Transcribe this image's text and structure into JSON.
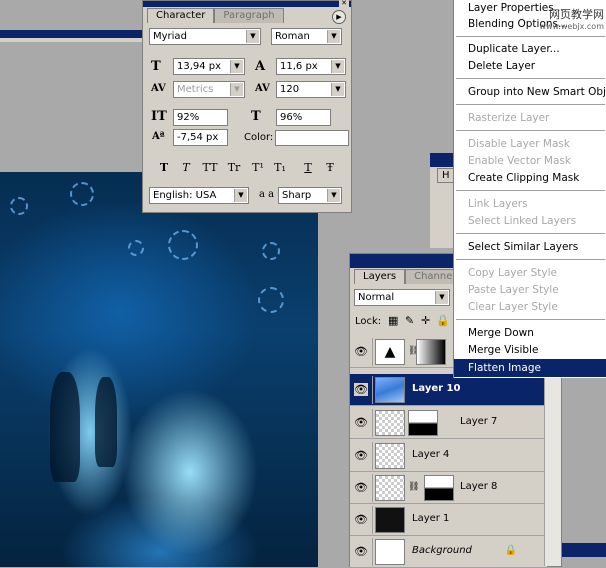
{
  "character_panel": {
    "tabs": [
      "Character",
      "Paragraph"
    ],
    "font_family": "Myriad",
    "font_style": "Roman",
    "font_size": "13,94 px",
    "leading": "11,6 px",
    "kerning": "Metrics",
    "tracking": "120",
    "vertical_scale": "92%",
    "horizontal_scale": "96%",
    "baseline_shift": "-7,54 px",
    "color_label": "Color:",
    "language": "English: USA",
    "antialias_label": "a a",
    "antialias": "Sharp",
    "style_buttons": [
      "T",
      "T",
      "TT",
      "Tr",
      "T¹",
      "T₁",
      "T",
      "Ŧ"
    ]
  },
  "mid_window": {
    "tab": "H"
  },
  "layers_panel": {
    "tabs": [
      "Layers",
      "Channels"
    ],
    "blend_mode": "Normal",
    "lock_label": "Lock:",
    "layers": [
      {
        "name": "",
        "selected": false
      },
      {
        "name": "Layer 10",
        "selected": true
      },
      {
        "name": "Layer 7",
        "selected": false
      },
      {
        "name": "Layer 4",
        "selected": false
      },
      {
        "name": "Layer 8",
        "selected": false
      },
      {
        "name": "Layer 1",
        "selected": false
      },
      {
        "name": "Background",
        "selected": false
      }
    ]
  },
  "context_menu": {
    "items": [
      {
        "label": "Layer Properties...",
        "disabled": false
      },
      {
        "label": "Blending Options...",
        "disabled": false
      },
      {
        "label": "Duplicate Layer...",
        "disabled": false
      },
      {
        "label": "Delete Layer",
        "disabled": false
      },
      {
        "label": "Group into New Smart Object",
        "disabled": false
      },
      {
        "label": "Rasterize Layer",
        "disabled": true
      },
      {
        "label": "Disable Layer Mask",
        "disabled": true
      },
      {
        "label": "Enable Vector Mask",
        "disabled": true
      },
      {
        "label": "Create Clipping Mask",
        "disabled": false
      },
      {
        "label": "Link Layers",
        "disabled": true
      },
      {
        "label": "Select Linked Layers",
        "disabled": true
      },
      {
        "label": "Select Similar Layers",
        "disabled": false
      },
      {
        "label": "Copy Layer Style",
        "disabled": true
      },
      {
        "label": "Paste Layer Style",
        "disabled": true
      },
      {
        "label": "Clear Layer Style",
        "disabled": true
      },
      {
        "label": "Merge Down",
        "disabled": false
      },
      {
        "label": "Merge Visible",
        "disabled": false
      },
      {
        "label": "Flatten Image",
        "disabled": false
      }
    ]
  },
  "watermark": {
    "line1": "网页教学网",
    "line2": "www.webjx.com"
  },
  "colors": {
    "titlebar": "#0a246a",
    "panel": "#d4d0c8",
    "highlight": "#0a246a"
  }
}
